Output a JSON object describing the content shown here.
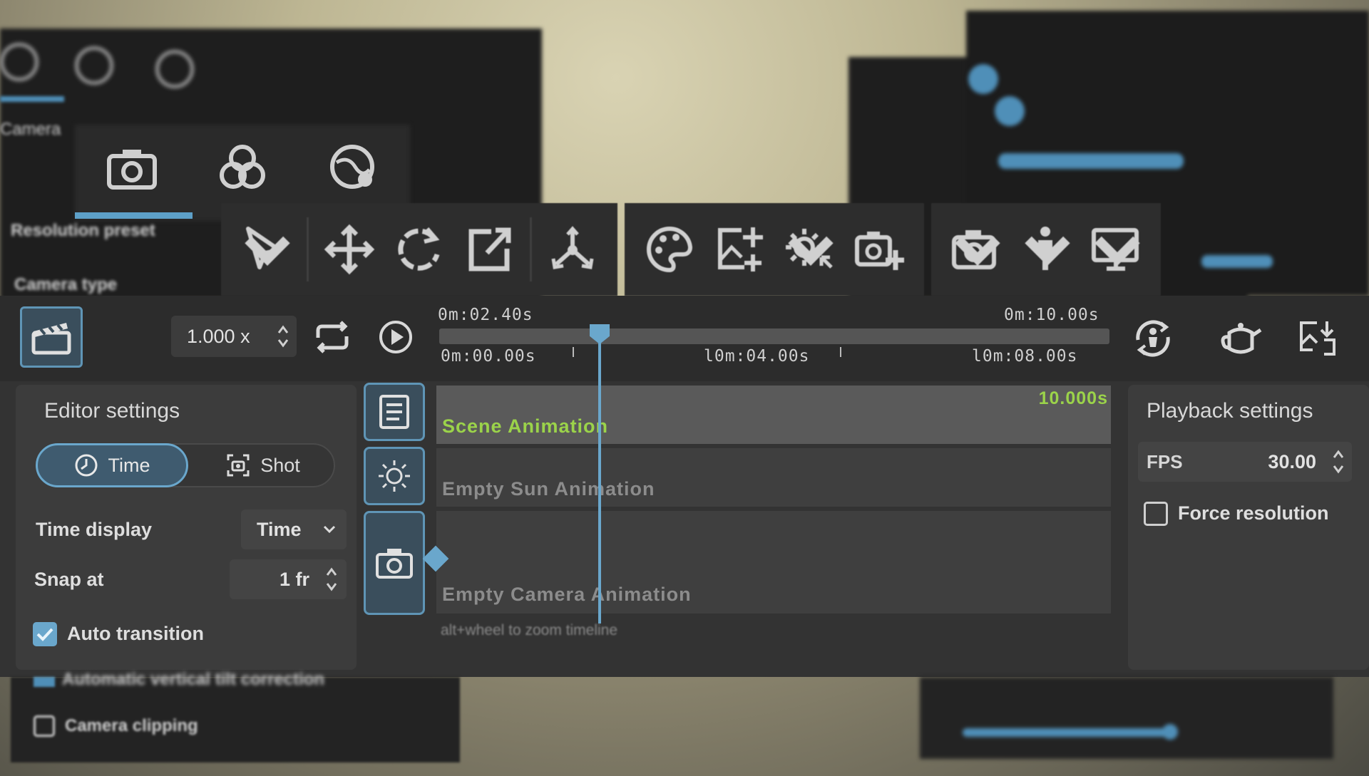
{
  "toolbar": {
    "groups": [
      {
        "name": "transform",
        "icons": [
          "select-cursor-icon",
          "move-icon",
          "rotate-icon",
          "scale-icon",
          "pivot-icon"
        ]
      },
      {
        "name": "materials",
        "icons": [
          "palette-icon",
          "add-image-icon",
          "add-light-icon",
          "add-camera-object-icon"
        ]
      },
      {
        "name": "view",
        "icons": [
          "camera-icon",
          "person-icon",
          "monitor-icon"
        ]
      }
    ]
  },
  "playback": {
    "speed": "1.000 x"
  },
  "timeline": {
    "current_time": "0m:02.40s",
    "end_time": "0m:10.00s",
    "ticks": [
      "0m:00.00s",
      "l0m:04.00s",
      "l0m:08.00s"
    ],
    "duration_label": "10.000s",
    "tracks": [
      {
        "name": "Scene Animation",
        "color": "#9bd34a"
      },
      {
        "name": "Empty Sun Animation",
        "color": "#8c8c8c"
      },
      {
        "name": "Empty Camera Animation",
        "color": "#8c8c8c"
      }
    ],
    "hint": "alt+wheel to zoom timeline",
    "playhead_fraction": 0.24
  },
  "editor_settings": {
    "title": "Editor settings",
    "mode_time": "Time",
    "mode_shot": "Shot",
    "time_display_label": "Time display",
    "time_display_value": "Time",
    "snap_label": "Snap at",
    "snap_value": "1 fr",
    "auto_transition_label": "Auto transition",
    "auto_transition_checked": true
  },
  "playback_settings": {
    "title": "Playback settings",
    "fps_label": "FPS",
    "fps_value": "30.00",
    "force_resolution_label": "Force resolution",
    "force_resolution_checked": false
  },
  "background": {
    "camera_clipping_label": "Camera clipping",
    "cut_off_label": "Automatic vertical tilt correction"
  },
  "colors": {
    "accent": "#6aa7cc",
    "track_active": "#9bd34a",
    "panel": "#3c3c3c"
  }
}
